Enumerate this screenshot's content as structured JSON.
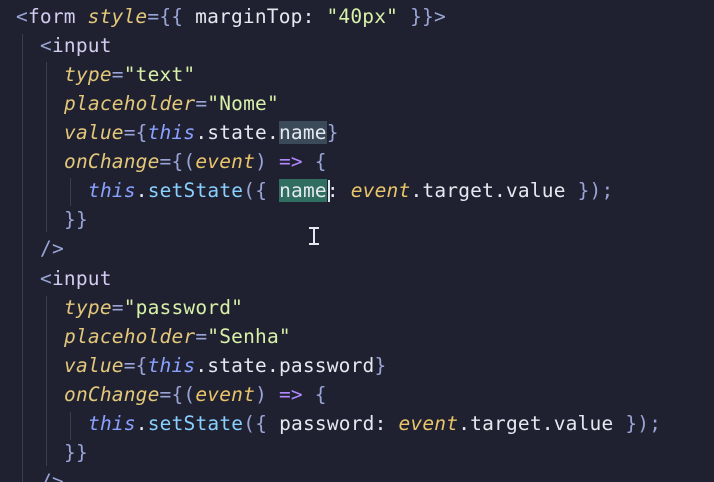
{
  "editor": {
    "lines": [
      {
        "tokens": [
          {
            "t": "<",
            "c": "punct"
          },
          {
            "t": "form",
            "c": "tag"
          },
          {
            "t": " ",
            "c": "plain"
          },
          {
            "t": "style",
            "c": "attr"
          },
          {
            "t": "={{",
            "c": "punct"
          },
          {
            "t": " marginTop: ",
            "c": "plain"
          },
          {
            "t": "\"40px\"",
            "c": "str"
          },
          {
            "t": " }}",
            "c": "punct"
          },
          {
            "t": ">",
            "c": "punct"
          }
        ]
      },
      {
        "indent": 1,
        "tokens": [
          {
            "t": "<",
            "c": "punct"
          },
          {
            "t": "input",
            "c": "tag"
          }
        ]
      },
      {
        "indent": 2,
        "tokens": [
          {
            "t": "type",
            "c": "attr"
          },
          {
            "t": "=",
            "c": "punct"
          },
          {
            "t": "\"text\"",
            "c": "str"
          }
        ]
      },
      {
        "indent": 2,
        "tokens": [
          {
            "t": "placeholder",
            "c": "attr"
          },
          {
            "t": "=",
            "c": "punct"
          },
          {
            "t": "\"Nome\"",
            "c": "str"
          }
        ]
      },
      {
        "indent": 2,
        "tokens": [
          {
            "t": "value",
            "c": "attr"
          },
          {
            "t": "={",
            "c": "punct"
          },
          {
            "t": "this",
            "c": "kw"
          },
          {
            "t": ".state.",
            "c": "plain"
          },
          {
            "t": "name",
            "c": "sel"
          },
          {
            "t": "}",
            "c": "punct"
          }
        ]
      },
      {
        "indent": 2,
        "tokens": [
          {
            "t": "onChange",
            "c": "attr"
          },
          {
            "t": "={(",
            "c": "punct"
          },
          {
            "t": "event",
            "c": "param"
          },
          {
            "t": ")",
            "c": "punct"
          },
          {
            "t": " => ",
            "c": "op"
          },
          {
            "t": "{",
            "c": "punct"
          }
        ]
      },
      {
        "indent": 3,
        "tokens": [
          {
            "t": "this",
            "c": "kw"
          },
          {
            "t": ".",
            "c": "plain"
          },
          {
            "t": "setState",
            "c": "fn"
          },
          {
            "t": "({ ",
            "c": "punct"
          },
          {
            "t": "name",
            "c": "sel2"
          },
          {
            "t": ": ",
            "c": "plain"
          },
          {
            "t": "event",
            "c": "param"
          },
          {
            "t": ".target.value ",
            "c": "plain"
          },
          {
            "t": "});",
            "c": "punct"
          }
        ]
      },
      {
        "indent": 2,
        "tokens": [
          {
            "t": "}}",
            "c": "punct"
          }
        ]
      },
      {
        "indent": 1,
        "tokens": [
          {
            "t": "/>",
            "c": "punct"
          }
        ]
      },
      {
        "indent": 1,
        "tokens": [
          {
            "t": "<",
            "c": "punct"
          },
          {
            "t": "input",
            "c": "tag"
          }
        ]
      },
      {
        "indent": 2,
        "tokens": [
          {
            "t": "type",
            "c": "attr"
          },
          {
            "t": "=",
            "c": "punct"
          },
          {
            "t": "\"password\"",
            "c": "str"
          }
        ]
      },
      {
        "indent": 2,
        "tokens": [
          {
            "t": "placeholder",
            "c": "attr"
          },
          {
            "t": "=",
            "c": "punct"
          },
          {
            "t": "\"Senha\"",
            "c": "str"
          }
        ]
      },
      {
        "indent": 2,
        "tokens": [
          {
            "t": "value",
            "c": "attr"
          },
          {
            "t": "={",
            "c": "punct"
          },
          {
            "t": "this",
            "c": "kw"
          },
          {
            "t": ".state.password",
            "c": "plain"
          },
          {
            "t": "}",
            "c": "punct"
          }
        ]
      },
      {
        "indent": 2,
        "tokens": [
          {
            "t": "onChange",
            "c": "attr"
          },
          {
            "t": "={(",
            "c": "punct"
          },
          {
            "t": "event",
            "c": "param"
          },
          {
            "t": ")",
            "c": "punct"
          },
          {
            "t": " => ",
            "c": "op"
          },
          {
            "t": "{",
            "c": "punct"
          }
        ]
      },
      {
        "indent": 3,
        "tokens": [
          {
            "t": "this",
            "c": "kw"
          },
          {
            "t": ".",
            "c": "plain"
          },
          {
            "t": "setState",
            "c": "fn"
          },
          {
            "t": "({ ",
            "c": "punct"
          },
          {
            "t": "password: ",
            "c": "plain"
          },
          {
            "t": "event",
            "c": "param"
          },
          {
            "t": ".target.value ",
            "c": "plain"
          },
          {
            "t": "});",
            "c": "punct"
          }
        ]
      },
      {
        "indent": 2,
        "tokens": [
          {
            "t": "}}",
            "c": "punct"
          }
        ]
      },
      {
        "indent": 1,
        "tokens": [
          {
            "t": "/>",
            "c": "punct"
          }
        ]
      }
    ]
  }
}
